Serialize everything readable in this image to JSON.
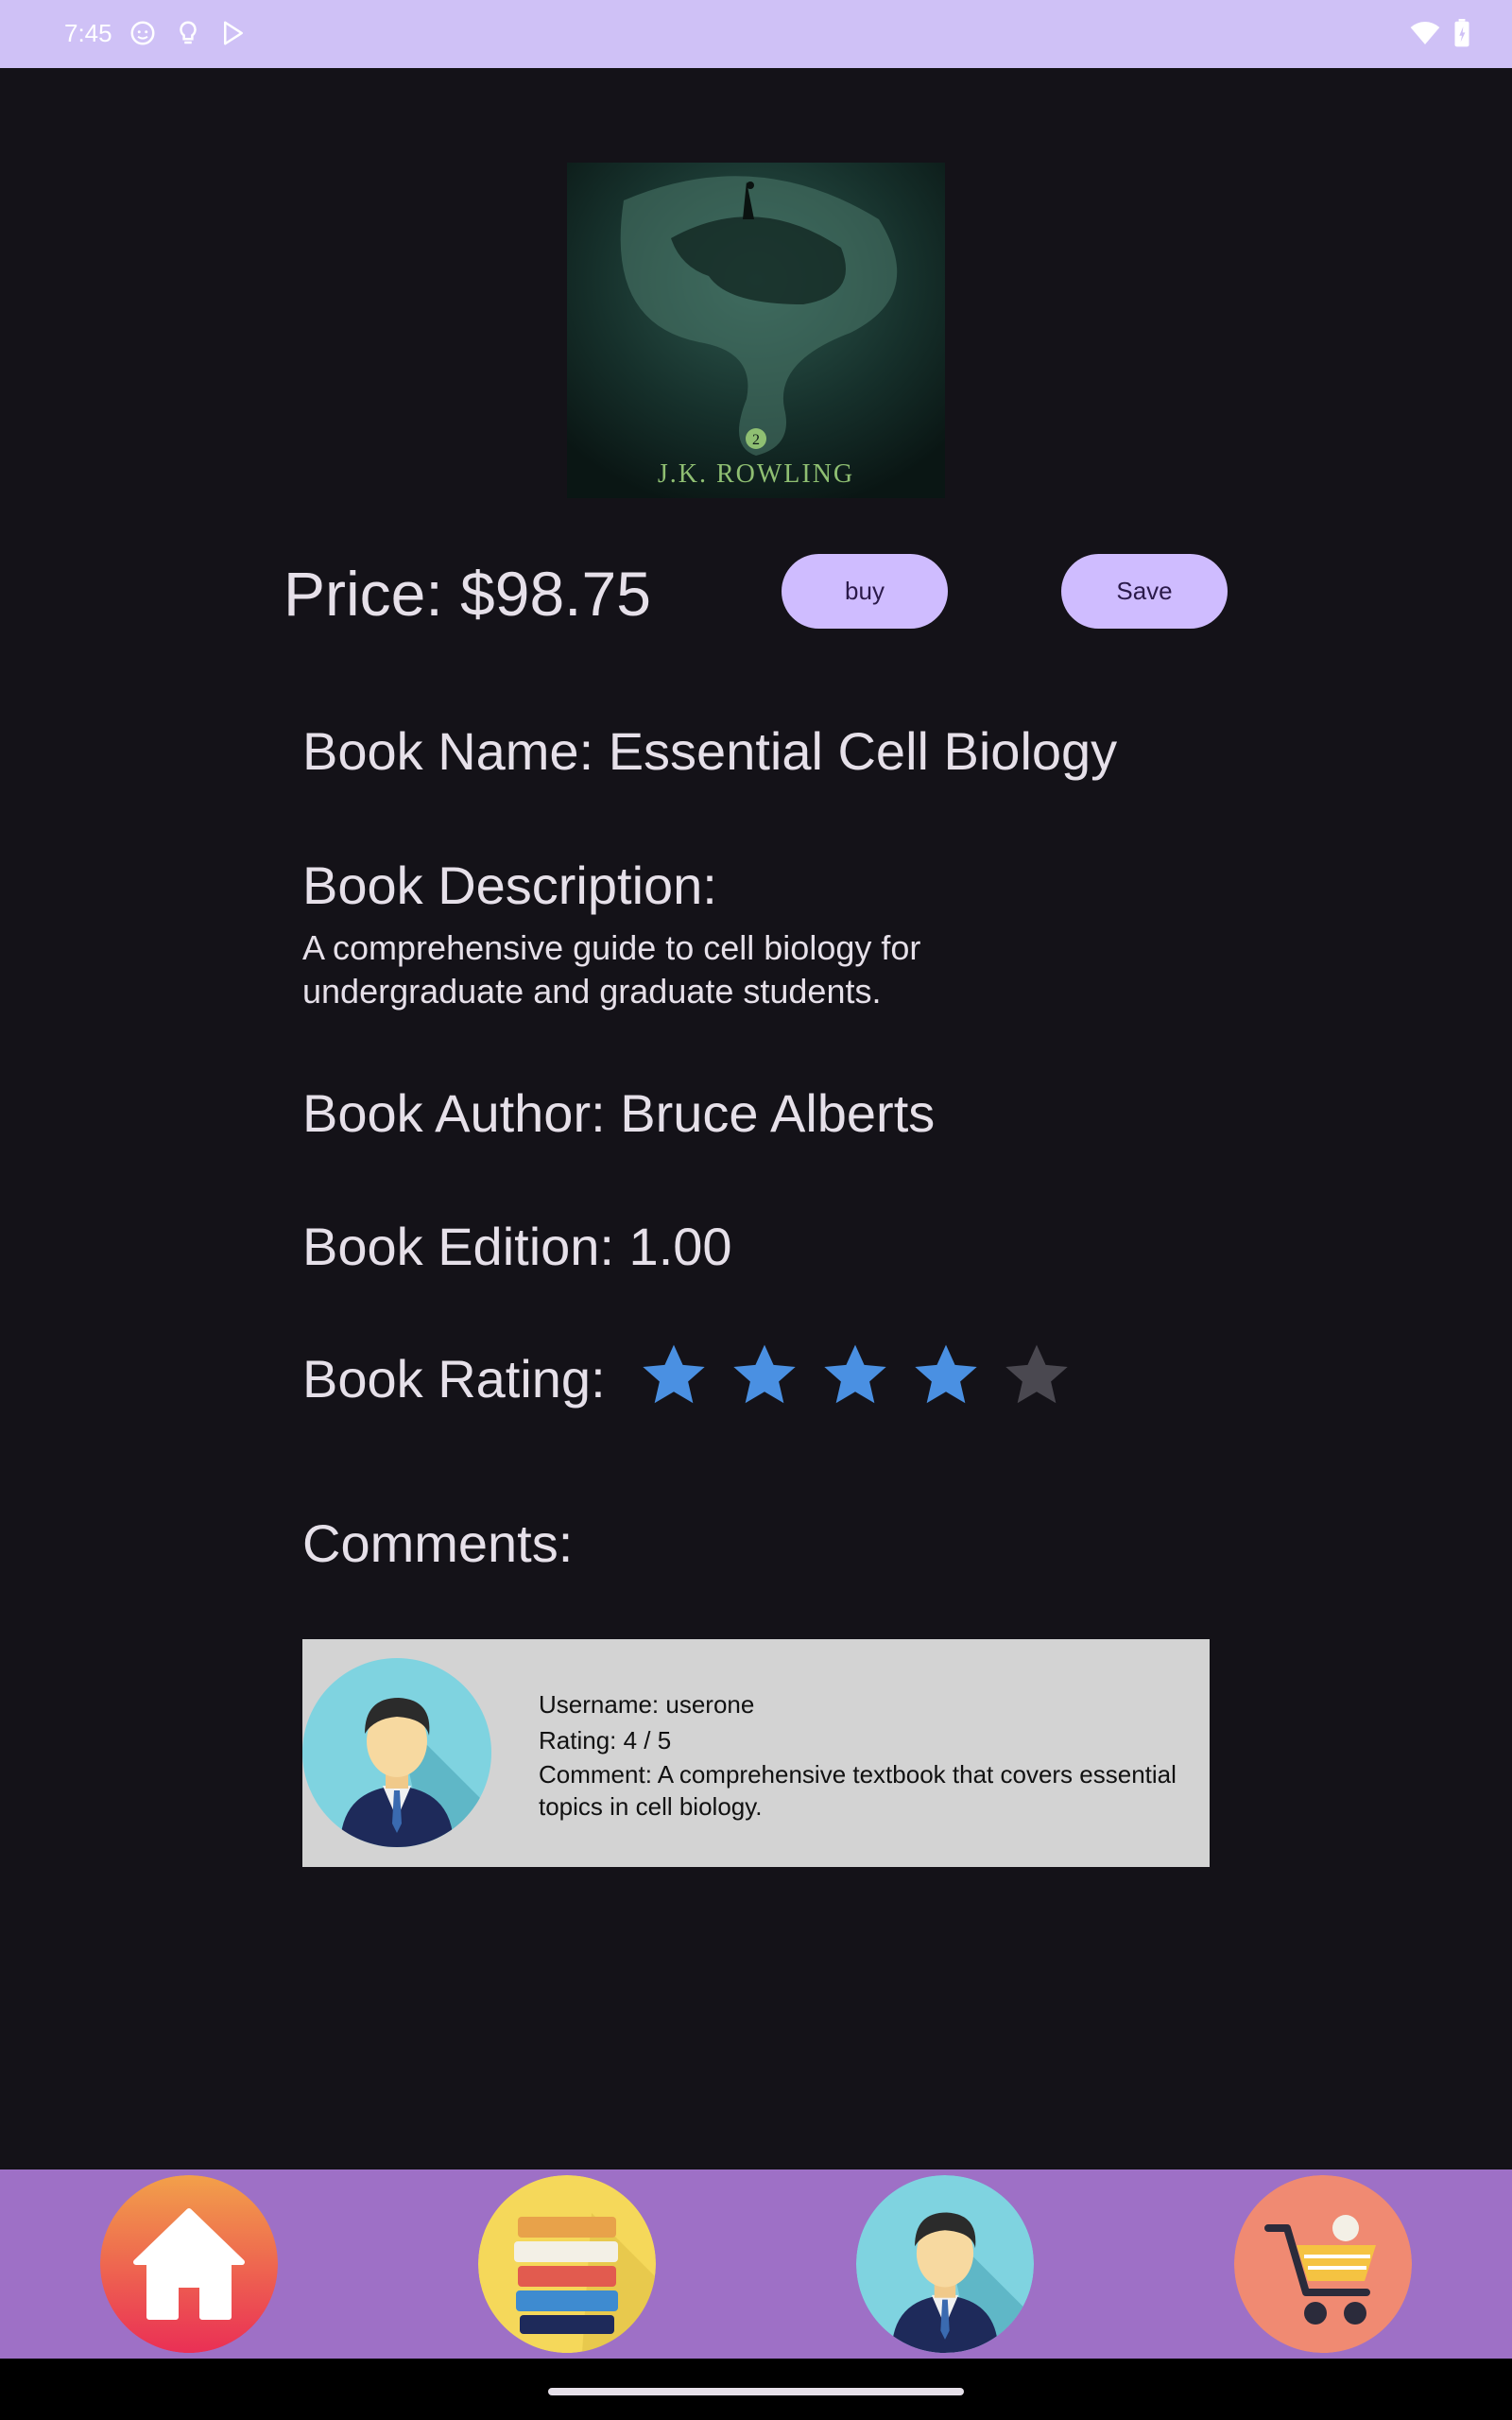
{
  "status_bar": {
    "time": "7:45",
    "left_icons": [
      "face-icon",
      "bulb-icon",
      "play-store-icon"
    ],
    "right_icons": [
      "wifi-icon",
      "battery-icon"
    ]
  },
  "book": {
    "cover_author_text": "J.K. ROWLING",
    "price_label": "Price: $98.75",
    "buy_label": "buy",
    "save_label": "Save",
    "name_line": "Book Name: Essential Cell Biology",
    "description_heading": "Book Description:",
    "description_text": "A comprehensive guide to cell biology for undergraduate and graduate students.",
    "author_line": "Book Author: Bruce Alberts",
    "edition_line": "Book Edition: 1.00",
    "rating_label": "Book Rating:",
    "rating_value": 4,
    "rating_max": 5
  },
  "comments": {
    "heading": "Comments:",
    "items": [
      {
        "username": "Username: userone",
        "rating": "Rating: 4 / 5",
        "comment": "Comment: A comprehensive textbook that covers essential topics in cell biology."
      }
    ]
  },
  "nav": {
    "items": [
      "home-icon",
      "books-icon",
      "profile-icon",
      "cart-icon"
    ]
  },
  "colors": {
    "background": "#141218",
    "status_bar": "#cfc1f6",
    "accent_button": "#cfbcff",
    "star_filled": "#4a90e2",
    "star_empty": "#4a4850",
    "nav_bar": "#9e70c6",
    "card": "#d3d3d3"
  }
}
